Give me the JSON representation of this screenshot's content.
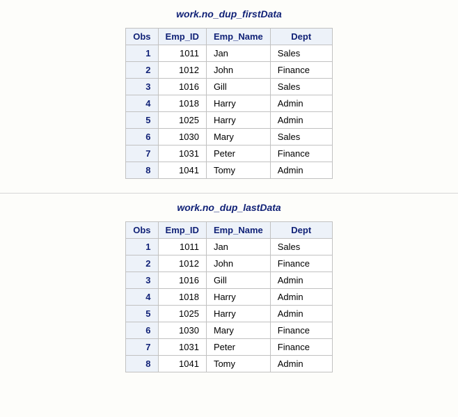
{
  "tables": [
    {
      "title": "work.no_dup_firstData",
      "columns": [
        "Obs",
        "Emp_ID",
        "Emp_Name",
        "Dept"
      ],
      "rows": [
        {
          "obs": "1",
          "emp_id": "1011",
          "emp_name": "Jan",
          "dept": "Sales"
        },
        {
          "obs": "2",
          "emp_id": "1012",
          "emp_name": "John",
          "dept": "Finance"
        },
        {
          "obs": "3",
          "emp_id": "1016",
          "emp_name": "Gill",
          "dept": "Sales"
        },
        {
          "obs": "4",
          "emp_id": "1018",
          "emp_name": "Harry",
          "dept": "Admin"
        },
        {
          "obs": "5",
          "emp_id": "1025",
          "emp_name": "Harry",
          "dept": "Admin"
        },
        {
          "obs": "6",
          "emp_id": "1030",
          "emp_name": "Mary",
          "dept": "Sales"
        },
        {
          "obs": "7",
          "emp_id": "1031",
          "emp_name": "Peter",
          "dept": "Finance"
        },
        {
          "obs": "8",
          "emp_id": "1041",
          "emp_name": "Tomy",
          "dept": "Admin"
        }
      ]
    },
    {
      "title": "work.no_dup_lastData",
      "columns": [
        "Obs",
        "Emp_ID",
        "Emp_Name",
        "Dept"
      ],
      "rows": [
        {
          "obs": "1",
          "emp_id": "1011",
          "emp_name": "Jan",
          "dept": "Sales"
        },
        {
          "obs": "2",
          "emp_id": "1012",
          "emp_name": "John",
          "dept": "Finance"
        },
        {
          "obs": "3",
          "emp_id": "1016",
          "emp_name": "Gill",
          "dept": "Admin"
        },
        {
          "obs": "4",
          "emp_id": "1018",
          "emp_name": "Harry",
          "dept": "Admin"
        },
        {
          "obs": "5",
          "emp_id": "1025",
          "emp_name": "Harry",
          "dept": "Admin"
        },
        {
          "obs": "6",
          "emp_id": "1030",
          "emp_name": "Mary",
          "dept": "Finance"
        },
        {
          "obs": "7",
          "emp_id": "1031",
          "emp_name": "Peter",
          "dept": "Finance"
        },
        {
          "obs": "8",
          "emp_id": "1041",
          "emp_name": "Tomy",
          "dept": "Admin"
        }
      ]
    }
  ]
}
